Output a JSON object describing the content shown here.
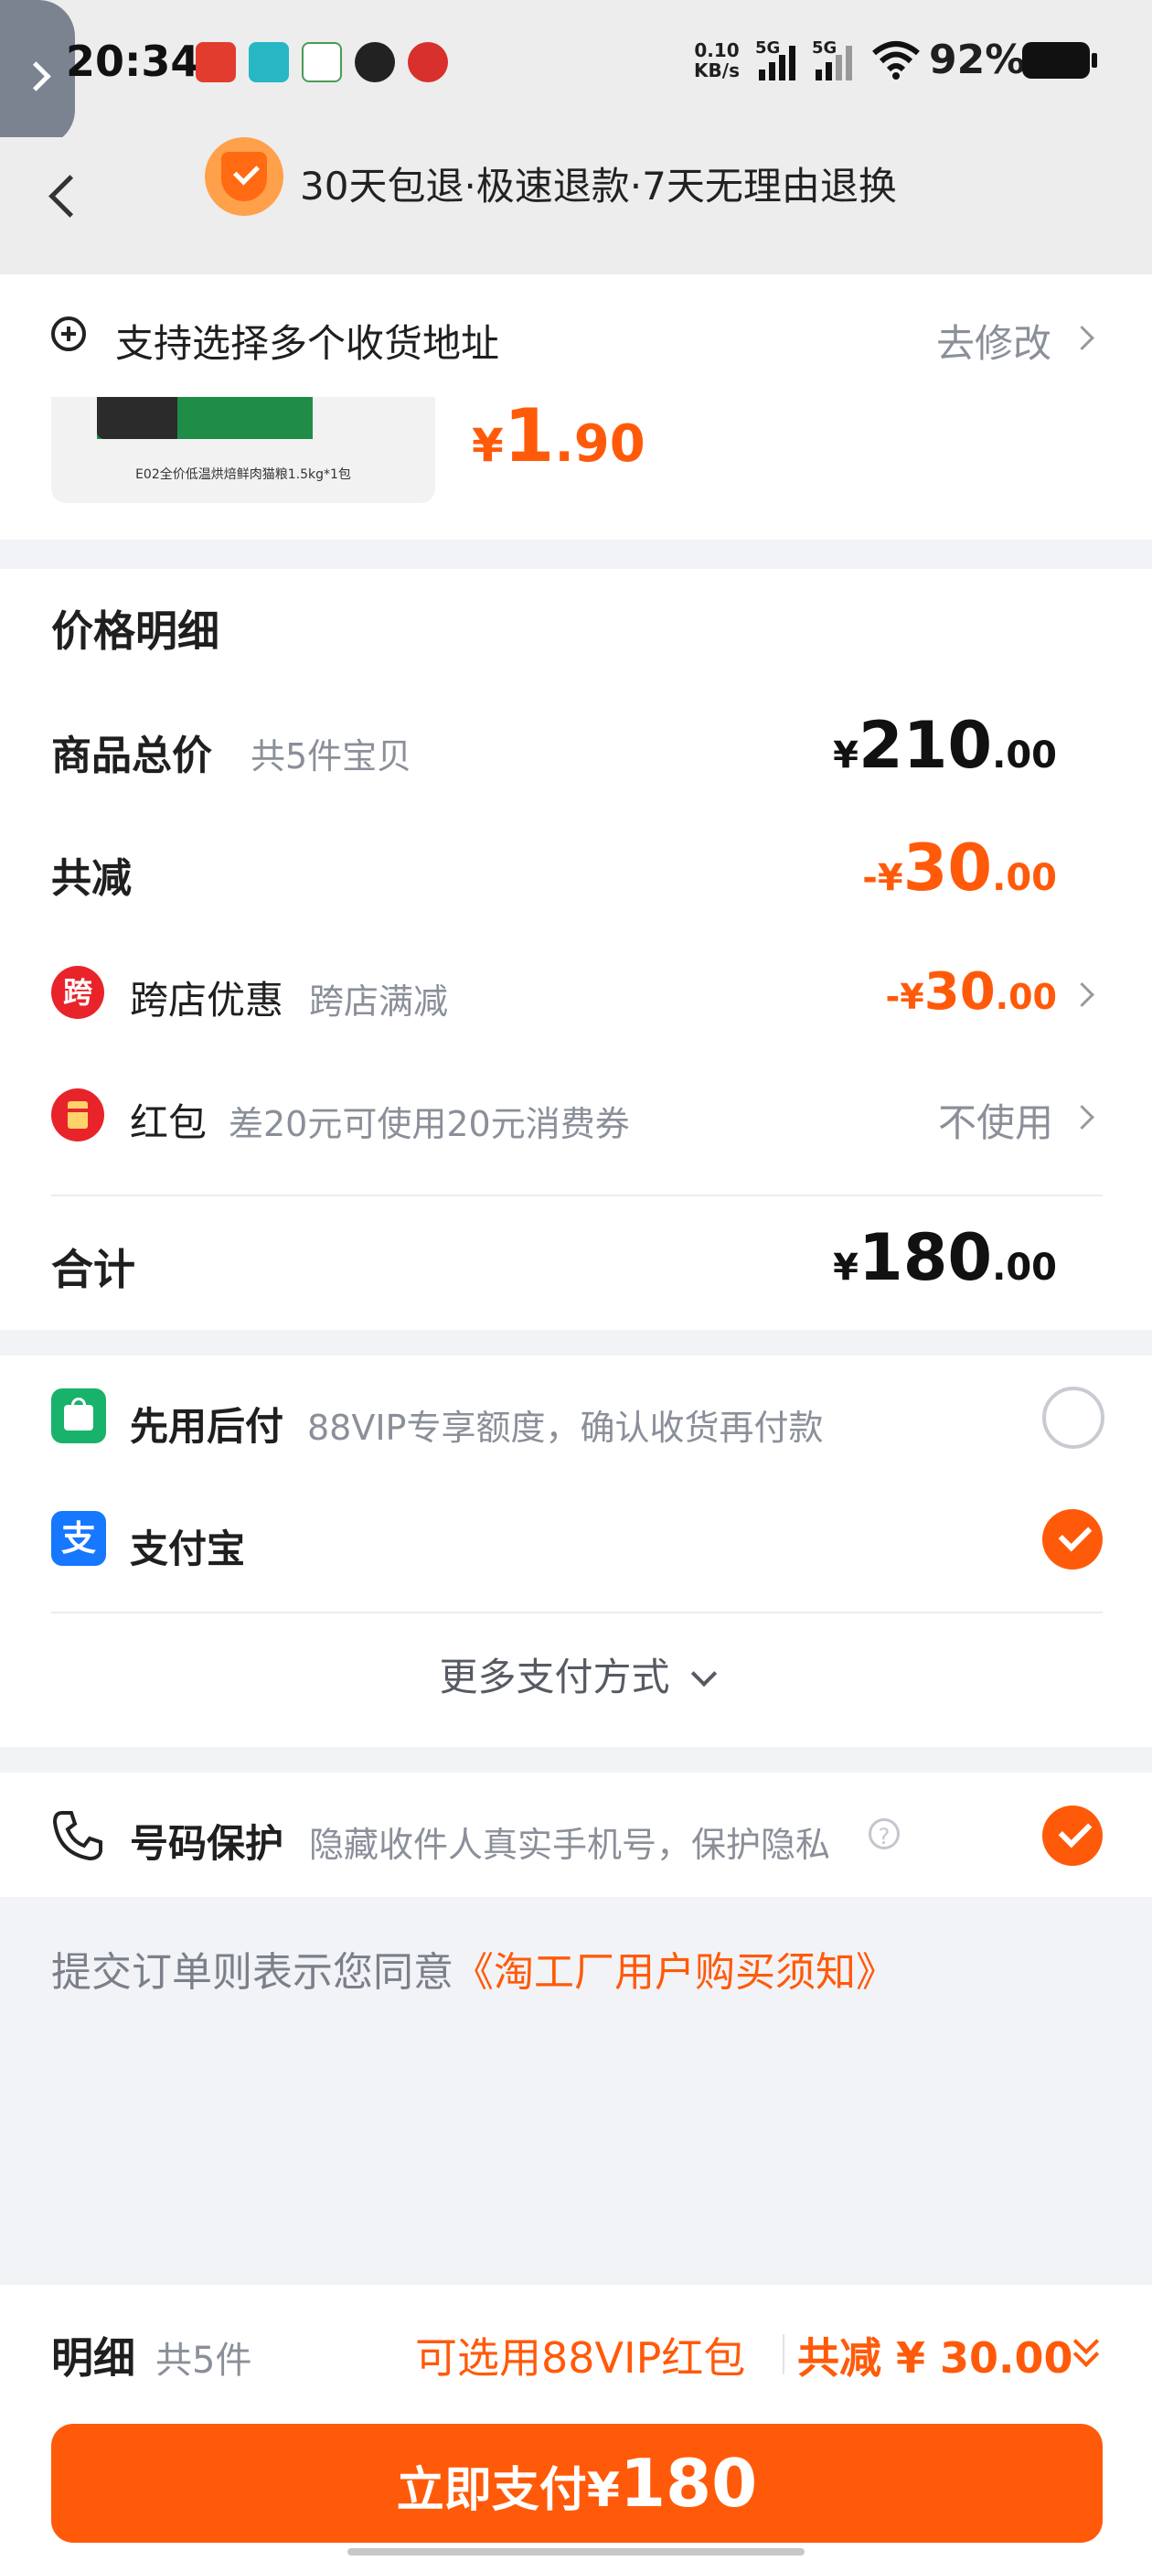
{
  "status_bar": {
    "time": "20:34",
    "net_speed_top": "0.10",
    "net_speed_bottom": "KB/s",
    "signal1": "5G",
    "signal2": "5G",
    "battery": "92%"
  },
  "header": {
    "guarantee": "30天包退·极速退款·7天无理由退换"
  },
  "address": {
    "label": "支持选择多个收货地址",
    "action": "去修改"
  },
  "product": {
    "name": "E02全价低温烘焙鲜肉猫粮1.5kg*1包",
    "price_symbol": "¥",
    "price_int": "1",
    "price_dec": ".90"
  },
  "price_detail": {
    "title": "价格明细",
    "goods_total_label": "商品总价",
    "goods_count": "共5件宝贝",
    "goods_total_symbol": "¥",
    "goods_total_int": "210",
    "goods_total_dec": ".00",
    "discount_label": "共减",
    "discount_symbol": "-¥",
    "discount_int": "30",
    "discount_dec": ".00",
    "cross_store_icon": "跨",
    "cross_store_label": "跨店优惠",
    "cross_store_sub": "跨店满减",
    "cross_store_symbol": "-¥",
    "cross_store_int": "30",
    "cross_store_dec": ".00",
    "redpacket_label": "红包",
    "redpacket_sub": "差20元可使用20元消费券",
    "redpacket_action": "不使用",
    "total_label": "合计",
    "total_symbol": "¥",
    "total_int": "180",
    "total_dec": ".00"
  },
  "payment": {
    "pay_later_label": "先用后付",
    "pay_later_sub": "88VIP专享额度，确认收货再付款",
    "alipay_icon": "支",
    "alipay_label": "支付宝",
    "more": "更多支付方式"
  },
  "privacy": {
    "label": "号码保护",
    "sub": "隐藏收件人真实手机号，保护隐私",
    "help": "?"
  },
  "agreement": {
    "prefix": "提交订单则表示您同意",
    "link": "《淘工厂用户购买须知》"
  },
  "footer": {
    "detail_label": "明细",
    "detail_count": "共5件",
    "vip_redpacket": "可选用88VIP红包",
    "total_discount": "共减 ¥ 30.00",
    "pay_button": "立即支付",
    "pay_symbol": "¥",
    "pay_amount": "180"
  },
  "colors": {
    "accent": "#ff5a0a",
    "alipay": "#1677ff",
    "pay_later": "#18b26b",
    "redpacket": "#e8242a"
  }
}
